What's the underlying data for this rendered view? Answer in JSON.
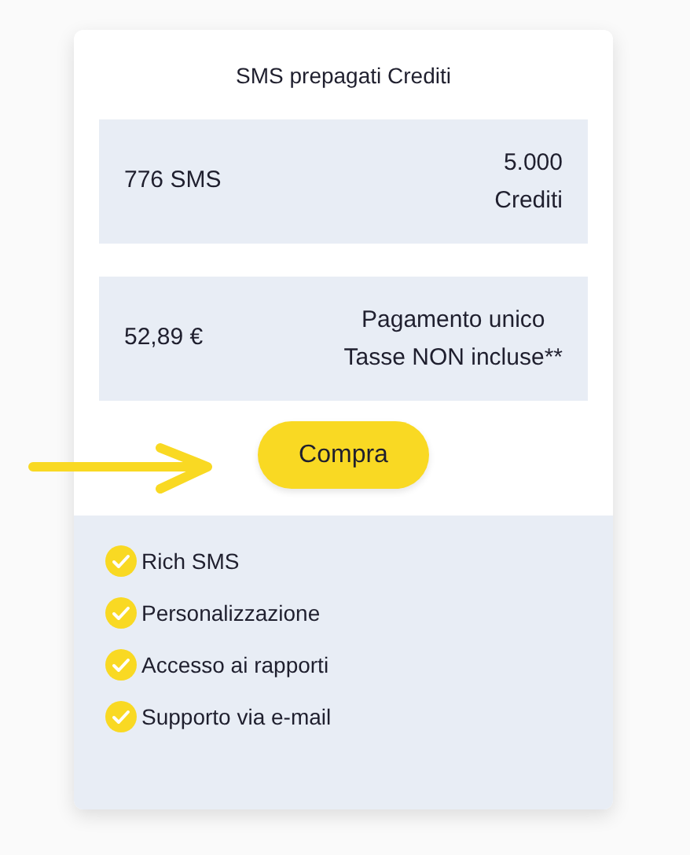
{
  "card": {
    "title": "SMS prepagati Crediti",
    "quantity": {
      "amount": "776 SMS",
      "credits_lines": [
        "5.000",
        "Crediti"
      ]
    },
    "price": {
      "amount": "52,89 €",
      "note_lines": [
        "Pagamento unico",
        "Tasse NON incluse**"
      ]
    },
    "button": "Compra",
    "features": [
      "Rich SMS",
      "Personalizzazione",
      "Accesso ai rapporti",
      "Supporto via e-mail"
    ]
  }
}
